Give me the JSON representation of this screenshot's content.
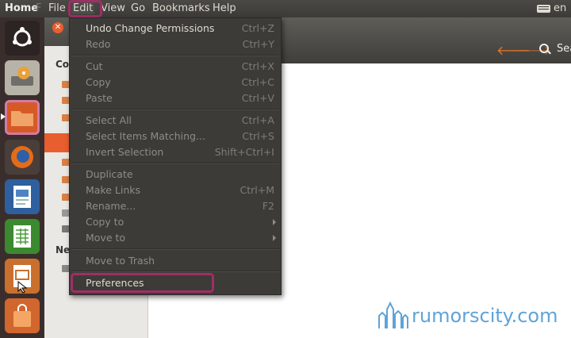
{
  "topbar": {
    "app_title": "Home",
    "faded_title_fragment": "F",
    "menus": [
      "File",
      "Edit",
      "View",
      "Go",
      "Bookmarks",
      "Help"
    ],
    "language": "en"
  },
  "launcher": {
    "items": [
      "ubuntu-dash",
      "disk-manager",
      "files",
      "firefox",
      "libreoffice-writer",
      "libreoffice-calc",
      "libreoffice-impress",
      "software-center"
    ]
  },
  "window": {
    "sidebar_headings": [
      "Co",
      "Ne"
    ],
    "search_label": "Sea"
  },
  "edit_menu": {
    "items": [
      {
        "label": "Undo Change Permissions",
        "accel": "Ctrl+Z",
        "enabled": true
      },
      {
        "label": "Redo",
        "accel": "Ctrl+Y",
        "enabled": false
      },
      {
        "label": "Cut",
        "accel": "Ctrl+X",
        "enabled": false
      },
      {
        "label": "Copy",
        "accel": "Ctrl+C",
        "enabled": false
      },
      {
        "label": "Paste",
        "accel": "Ctrl+V",
        "enabled": false
      },
      {
        "label": "Select All",
        "accel": "Ctrl+A",
        "enabled": false
      },
      {
        "label": "Select Items Matching...",
        "accel": "Ctrl+S",
        "enabled": false
      },
      {
        "label": "Invert Selection",
        "accel": "Shift+Ctrl+I",
        "enabled": false
      },
      {
        "label": "Duplicate",
        "accel": "",
        "enabled": false
      },
      {
        "label": "Make Links",
        "accel": "Ctrl+M",
        "enabled": false
      },
      {
        "label": "Rename...",
        "accel": "F2",
        "enabled": false
      },
      {
        "label": "Copy to",
        "accel": "",
        "enabled": false
      },
      {
        "label": "Move to",
        "accel": "",
        "enabled": false
      },
      {
        "label": "Move to Trash",
        "accel": "",
        "enabled": false
      },
      {
        "label": "Preferences",
        "accel": "",
        "enabled": true
      }
    ]
  },
  "watermark": {
    "text": "rumorscity.com"
  },
  "colors": {
    "highlight": "#a02e66",
    "accent": "#e95e2e",
    "menu_bg": "#3c3b37"
  }
}
